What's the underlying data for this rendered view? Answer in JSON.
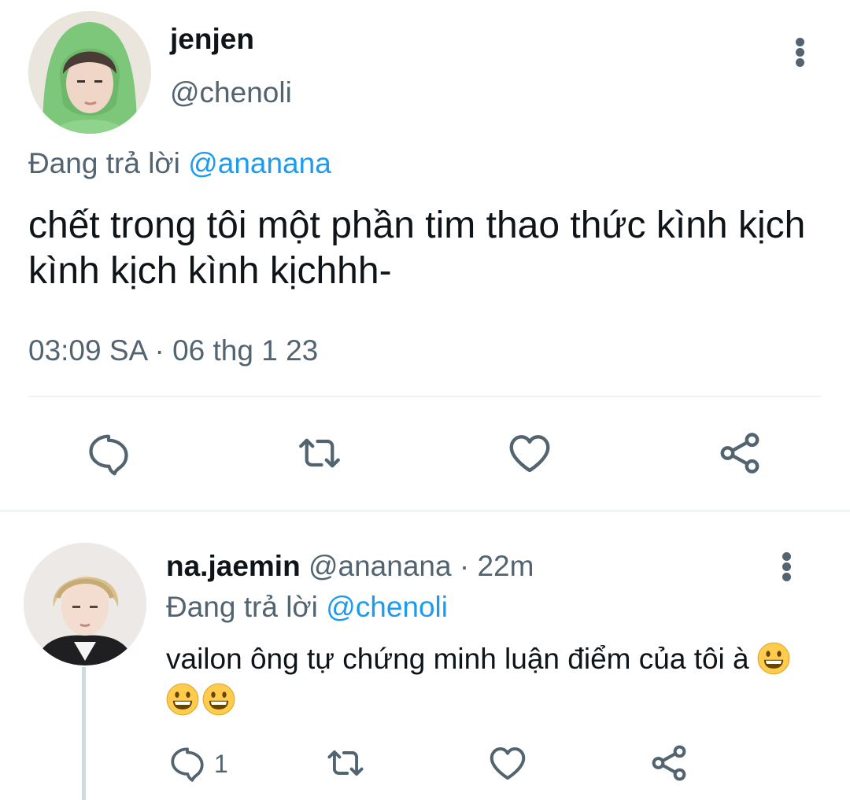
{
  "main_tweet": {
    "display_name": "jenjen",
    "handle": "@chenoli",
    "replying_prefix": "Đang trả lời",
    "replying_to": "@ananana",
    "text": "chết trong tôi một phần tim thao thức kình kịch kình kịch kình kịchhh-",
    "timestamp": "03:09 SA · 06 thg 1 23",
    "actions": [
      "reply-icon",
      "retweet-icon",
      "like-icon",
      "share-icon"
    ]
  },
  "reply_tweet": {
    "display_name": "na.jaemin",
    "handle": "@ananana",
    "separator": "·",
    "time_ago": "22m",
    "replying_prefix": "Đang trả lời",
    "replying_to": "@chenoli",
    "text": "vailon ông tự chứng minh luận điểm của tôi à",
    "emoji": [
      "grinning-face-emoji",
      "grinning-face-emoji",
      "grinning-face-emoji"
    ],
    "reply_count": "1",
    "actions": [
      "reply-icon",
      "retweet-icon",
      "like-icon",
      "share-icon"
    ]
  },
  "colors": {
    "text": "#0f1419",
    "muted": "#536471",
    "link": "#1d9bf0",
    "divider": "#eff3f4",
    "thread_line": "#cfd9de"
  }
}
